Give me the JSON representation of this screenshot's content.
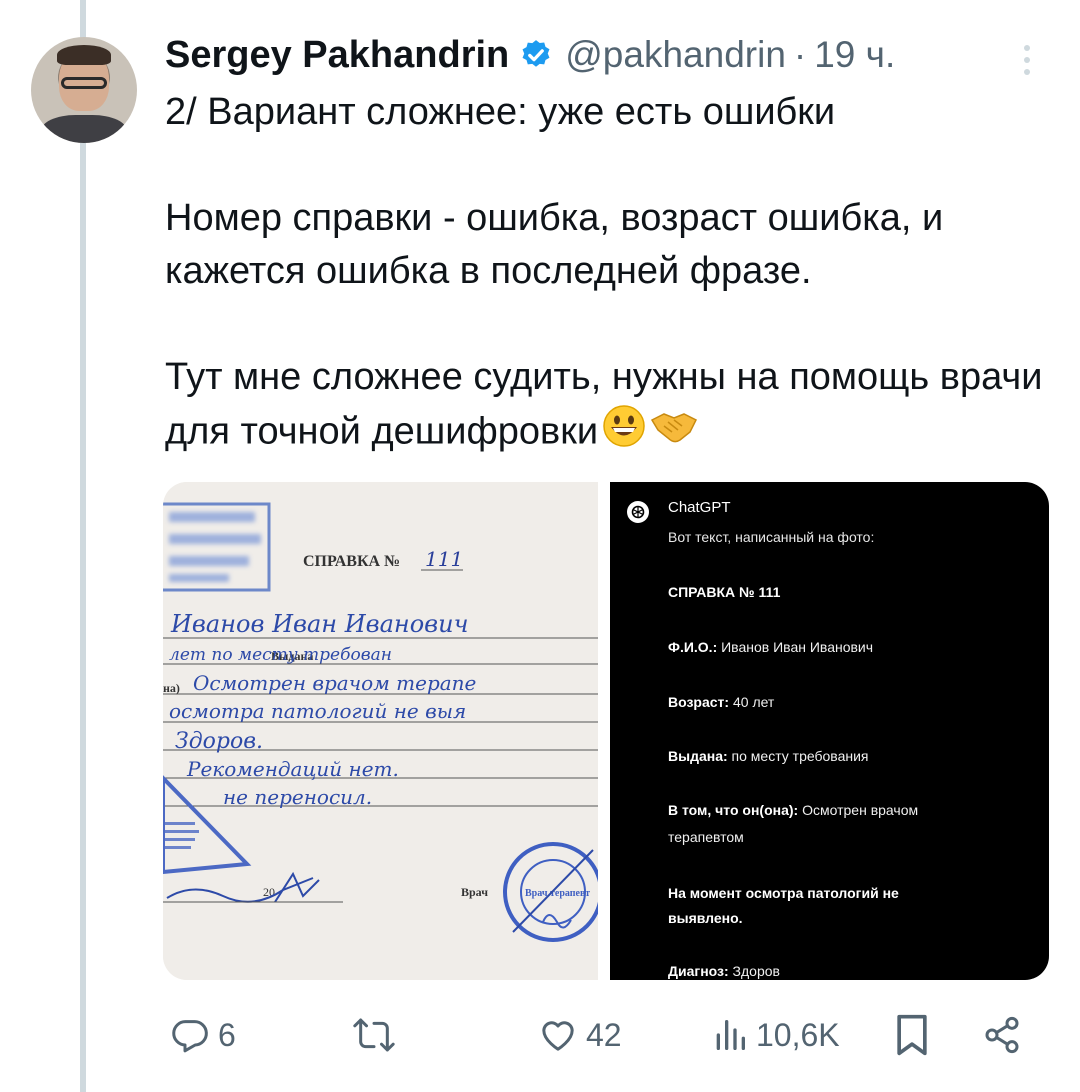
{
  "author": {
    "name": "Sergey Pakhandrin",
    "handle": "@pakhandrin",
    "separator": "·",
    "time": "19 ч."
  },
  "tweet": {
    "paragraph1": "2/ Вариант сложнее: уже есть ошибки",
    "paragraph2": "Номер справки - ошибка, возраст ошибка, и кажется ошибка в последней фразе.",
    "paragraph3": "Тут мне сложнее судить, нужны на помощь врачи для точной дешифровки",
    "emojis": [
      "grinning-face",
      "handshake"
    ]
  },
  "photo": {
    "form_title": "СПРАВКА №",
    "handwritten_number": "111",
    "label_issued": "Выдана",
    "label_a": "на)",
    "year_prefix": "20",
    "label_doctor": "Врач",
    "stamp_text": "Врач терапевт",
    "handwritten_lines": [
      "Иванов Иван Иванович",
      "лет   по месту требован",
      "Осмотрен врачом терапе",
      "осмотра патологий не выя",
      "Здоров.",
      "Рекомендаций нет.",
      "не переносил."
    ]
  },
  "chatgpt": {
    "app": "ChatGPT",
    "intro": "Вот текст, написанный на фото:",
    "lines": [
      {
        "label": "СПРАВКА № 111",
        "value": ""
      },
      {
        "label": "Ф.И.О.:",
        "value": " Иванов Иван Иванович"
      },
      {
        "label": "Возраст:",
        "value": " 40 лет"
      },
      {
        "label": "Выдана:",
        "value": " по месту требования"
      },
      {
        "label": "В том, что он(она):",
        "value": " Осмотрен врачом"
      },
      {
        "label": "",
        "value": "терапевтом"
      },
      {
        "label": "На момент осмотра патологий не",
        "value": ""
      },
      {
        "label": "выявлено.",
        "value": ""
      },
      {
        "label": "Диагноз:",
        "value": " Здоров"
      }
    ]
  },
  "actions": {
    "replies": "6",
    "retweets": "",
    "likes": "42",
    "views": "10,6K"
  },
  "colors": {
    "text": "#0f1419",
    "secondary": "#536471",
    "verified": "#1d9bf0",
    "thread": "#cfd9de"
  }
}
